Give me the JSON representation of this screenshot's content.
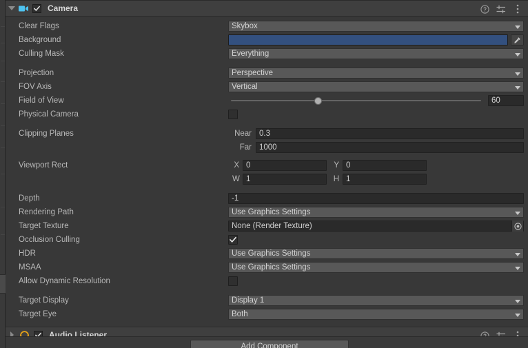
{
  "colors": {
    "panel_bg": "#383838",
    "header_bg": "#3f3f3f",
    "dropdown_bg": "#585858",
    "field_bg": "#2a2a2a",
    "background_color_value": "#33507f",
    "camera_icon": "#4ec3f0",
    "audio_icon": "#e8a317",
    "text": "#b8b8b8"
  },
  "camera_component": {
    "title": "Camera",
    "enabled": true,
    "expanded": true,
    "icon": "video-camera-icon",
    "header_actions": [
      {
        "name": "help-icon",
        "glyph": "?"
      },
      {
        "name": "preset-icon",
        "glyph": "sliders"
      },
      {
        "name": "more-menu-icon",
        "glyph": "kebab"
      }
    ],
    "properties": [
      {
        "label": "Clear Flags",
        "type": "dropdown",
        "value": "Skybox"
      },
      {
        "label": "Background",
        "type": "color",
        "value": "#33507f"
      },
      {
        "label": "Culling Mask",
        "type": "dropdown",
        "value": "Everything"
      },
      {
        "label": "Projection",
        "type": "dropdown",
        "value": "Perspective"
      },
      {
        "label": "FOV Axis",
        "type": "dropdown",
        "value": "Vertical"
      },
      {
        "label": "Field of View",
        "type": "slider",
        "value": "60",
        "slider_percent": 35
      },
      {
        "label": "Physical Camera",
        "type": "checkbox",
        "checked": false
      },
      {
        "label": "Clipping Planes",
        "type": "pair_vertical",
        "fields": [
          {
            "prefix": "Near",
            "value": "0.3"
          },
          {
            "prefix": "Far",
            "value": "1000"
          }
        ]
      },
      {
        "label": "Viewport Rect",
        "type": "rect",
        "fields": [
          {
            "prefix": "X",
            "value": "0"
          },
          {
            "prefix": "Y",
            "value": "0"
          },
          {
            "prefix": "W",
            "value": "1"
          },
          {
            "prefix": "H",
            "value": "1"
          }
        ]
      },
      {
        "label": "Depth",
        "type": "field",
        "value": "-1"
      },
      {
        "label": "Rendering Path",
        "type": "dropdown",
        "value": "Use Graphics Settings"
      },
      {
        "label": "Target Texture",
        "type": "object",
        "value": "None (Render Texture)"
      },
      {
        "label": "Occlusion Culling",
        "type": "checkbox",
        "checked": true
      },
      {
        "label": "HDR",
        "type": "dropdown",
        "value": "Use Graphics Settings"
      },
      {
        "label": "MSAA",
        "type": "dropdown",
        "value": "Use Graphics Settings"
      },
      {
        "label": "Allow Dynamic Resolution",
        "type": "checkbox",
        "checked": false
      },
      {
        "label": "Target Display",
        "type": "dropdown",
        "value": "Display 1"
      },
      {
        "label": "Target Eye",
        "type": "dropdown",
        "value": "Both"
      }
    ]
  },
  "audio_listener_component": {
    "title": "Audio Listener",
    "enabled": true,
    "expanded": false,
    "icon": "headphones-icon"
  },
  "add_component_button": {
    "label": "Add Component"
  }
}
